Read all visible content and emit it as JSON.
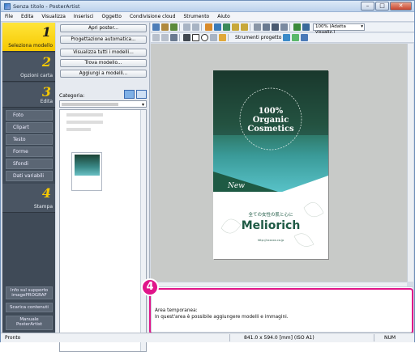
{
  "window": {
    "title": "Senza titolo - PosterArtist",
    "controls": {
      "minimize": "–",
      "maximize": "□",
      "close": "✕"
    }
  },
  "menubar": [
    "File",
    "Edita",
    "Visualizza",
    "Inserisci",
    "Oggetto",
    "Condivisione cloud",
    "Strumento",
    "Aiuto"
  ],
  "steps": [
    {
      "num": "1",
      "label": "Seleziona modello",
      "active": true
    },
    {
      "num": "2",
      "label": "Opzioni carta",
      "active": false
    },
    {
      "num": "3",
      "label": "Edita",
      "active": false
    },
    {
      "num": "4",
      "label": "Stampa",
      "active": false
    }
  ],
  "edit_items": [
    "Foto",
    "Clipart",
    "Testo",
    "Forme",
    "Sfondi",
    "Dati variabili"
  ],
  "bottom_buttons": [
    "Info sul supporto imagePROGRAF",
    "Scarica contenuti",
    "Manuale PosterArtist"
  ],
  "template_panel": {
    "buttons": [
      "Apri poster...",
      "Progettazione automatica...",
      "Visualizza tutti i modelli...",
      "Trova modello...",
      "Aggiungi a modelli..."
    ],
    "category_label": "Categoria:"
  },
  "toolbar": {
    "zoom": "100% (Adatta visualiz.)",
    "strumenti_label": "Strumenti progetto"
  },
  "poster": {
    "headline": [
      "100%",
      "Organic",
      "Cosmetics"
    ],
    "new_label": "New",
    "jp_tagline": "全ての女性の肌と心に",
    "brand": "Meliorich",
    "url": "http://xxxxxx.co.jp"
  },
  "badge": "4",
  "temp_area": {
    "line1": "Area temporanea:",
    "line2": "In quest'area è possibile aggiungere modelli e immagini."
  },
  "status": {
    "left": "Pronto",
    "size": "841.0 x 594.0 [mm] (ISO A1)",
    "num": "NUM"
  },
  "colors": {
    "accent_yellow": "#f6c800",
    "highlight_pink": "#e0158a",
    "poster_green": "#1e5a44"
  }
}
